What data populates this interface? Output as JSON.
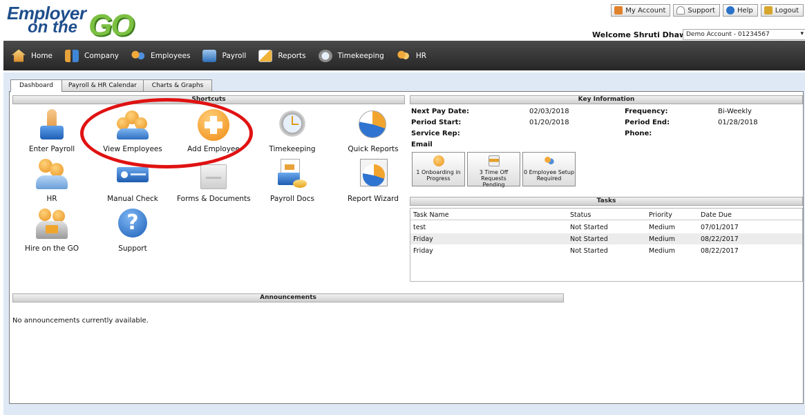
{
  "logo": {
    "line1": "Employer",
    "line2": "on the",
    "go": "GO"
  },
  "top_links": [
    {
      "label": "My Account",
      "icon": "user-icon",
      "color": "#e0812b"
    },
    {
      "label": "Support",
      "icon": "support-icon",
      "color": "#9c9c9c"
    },
    {
      "label": "Help",
      "icon": "help-icon",
      "color": "#2b72c9"
    },
    {
      "label": "Logout",
      "icon": "logout-icon",
      "color": "#d7a62d"
    }
  ],
  "welcome": "Welcome Shruti Dhawan",
  "account_select": "Demo Account - 01234567",
  "nav": [
    {
      "label": "Home",
      "icon": "home-icon"
    },
    {
      "label": "Company",
      "icon": "company-icon"
    },
    {
      "label": "Employees",
      "icon": "employees-icon"
    },
    {
      "label": "Payroll",
      "icon": "payroll-icon"
    },
    {
      "label": "Reports",
      "icon": "reports-icon"
    },
    {
      "label": "Timekeeping",
      "icon": "timekeeping-icon"
    },
    {
      "label": "HR",
      "icon": "hr-icon"
    }
  ],
  "tabs": [
    "Dashboard",
    "Payroll & HR Calendar",
    "Charts & Graphs"
  ],
  "sections": {
    "shortcuts": "Shortcuts",
    "key_info": "Key Information",
    "tasks": "Tasks",
    "announcements": "Announcements"
  },
  "shortcuts": [
    {
      "label": "Enter Payroll",
      "icon": "enter-payroll-icon"
    },
    {
      "label": "View Employees",
      "icon": "view-employees-icon"
    },
    {
      "label": "Add Employee",
      "icon": "add-employee-icon"
    },
    {
      "label": "Timekeeping",
      "icon": "timekeeping-icon"
    },
    {
      "label": "Quick Reports",
      "icon": "quick-reports-icon"
    },
    {
      "label": "HR",
      "icon": "hr-icon"
    },
    {
      "label": "Manual Check",
      "icon": "manual-check-icon"
    },
    {
      "label": "Forms & Documents",
      "icon": "forms-documents-icon"
    },
    {
      "label": "Payroll Docs",
      "icon": "payroll-docs-icon"
    },
    {
      "label": "Report Wizard",
      "icon": "report-wizard-icon"
    },
    {
      "label": "Hire on the GO",
      "icon": "hire-on-the-go-icon"
    },
    {
      "label": "Support",
      "icon": "support-icon"
    }
  ],
  "key_info": {
    "next_pay_date_label": "Next Pay Date:",
    "next_pay_date": "02/03/2018",
    "frequency_label": "Frequency:",
    "frequency": "Bi-Weekly",
    "period_start_label": "Period Start:",
    "period_start": "01/20/2018",
    "period_end_label": "Period End:",
    "period_end": "01/28/2018",
    "service_rep_label": "Service Rep:",
    "phone_label": "Phone:",
    "email_label": "Email"
  },
  "status_buttons": [
    {
      "line1": "1 Onboarding in",
      "line2": "Progress"
    },
    {
      "line1": "3 Time Off Requests",
      "line2": "Pending"
    },
    {
      "line1": "0 Employee Setup",
      "line2": "Required"
    }
  ],
  "tasks": {
    "headers": [
      "Task Name",
      "Status",
      "Priority",
      "Date Due"
    ],
    "rows": [
      [
        "test",
        "Not Started",
        "Medium",
        "07/01/2017"
      ],
      [
        "Friday",
        "Not Started",
        "Medium",
        "08/22/2017"
      ],
      [
        "Friday",
        "Not Started",
        "Medium",
        "08/22/2017"
      ]
    ]
  },
  "announcements_text": "No announcements currently available.",
  "colors": {
    "navbar": "#2f2f2f",
    "panel": "#dfe9f6",
    "annotation": "#e01212",
    "brand_blue": "#1f4e8c",
    "brand_green": "#7cc043"
  }
}
